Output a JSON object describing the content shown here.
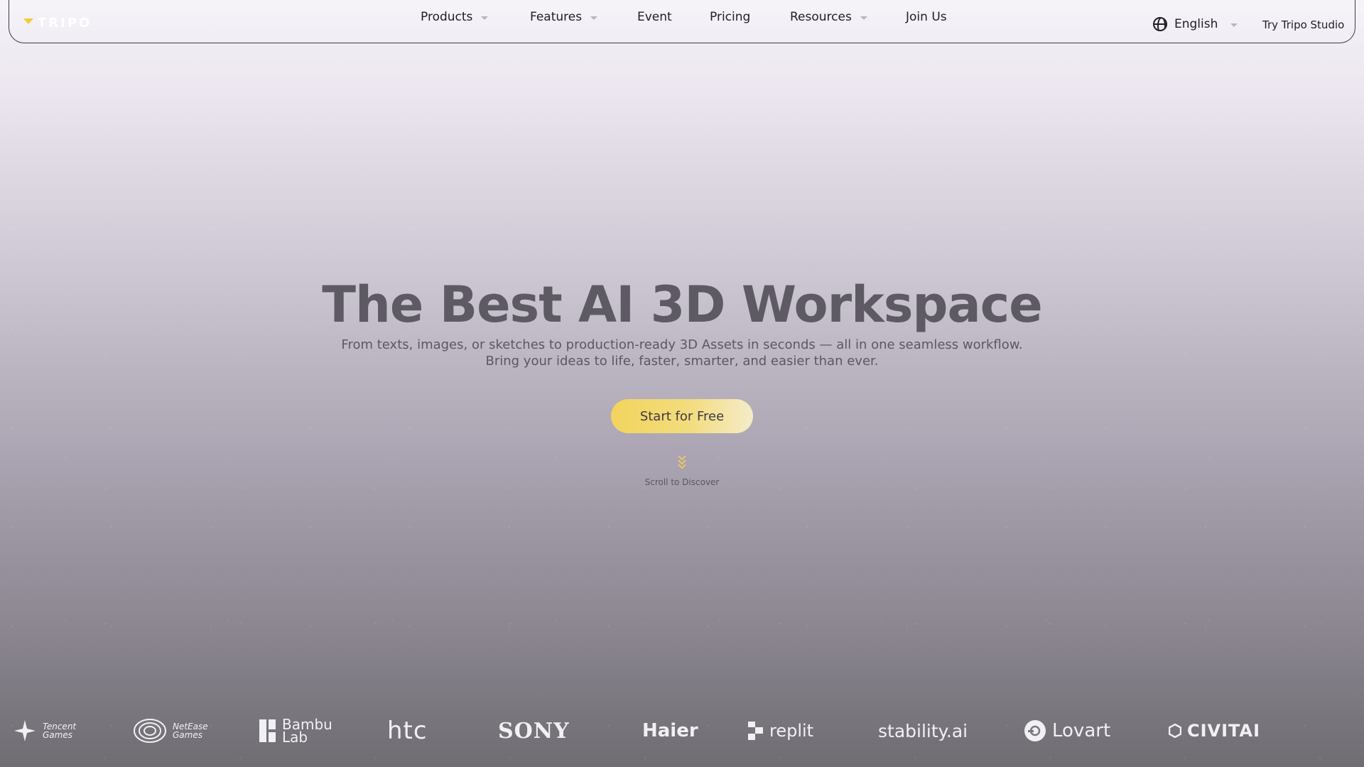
{
  "nav": {
    "logo_text": "TRIPO",
    "menu": [
      {
        "label": "Products",
        "has_dropdown": true
      },
      {
        "label": "Features",
        "has_dropdown": true
      },
      {
        "label": "Event",
        "has_dropdown": false
      },
      {
        "label": "Pricing",
        "has_dropdown": false
      },
      {
        "label": "Resources",
        "has_dropdown": true
      },
      {
        "label": "Join Us",
        "has_dropdown": false
      }
    ],
    "language": "English",
    "try_label": "Try Tripo Studio"
  },
  "hero": {
    "title": "The Best AI 3D Workspace",
    "subtitle_line1": "From texts, images, or sketches to production-ready 3D Assets in seconds — all in one seamless workflow.",
    "subtitle_line2": "Bring your ideas to life, faster, smarter, and easier than ever.",
    "cta_label": "Start for Free",
    "scroll_label": "Scroll to Discover"
  },
  "partners": {
    "tencent": {
      "line1": "Tencent",
      "line2": "Games"
    },
    "netease": {
      "line1": "NetEase",
      "line2": "Games"
    },
    "bambu": {
      "line1": "Bambu",
      "line2": "Lab"
    },
    "htc": "htc",
    "sony": "SONY",
    "haier": "Haier",
    "replit": "replit",
    "stability": "stability.ai",
    "lovart": "Lovart",
    "civitai": "CIVITAI"
  },
  "colors": {
    "accent": "#f2cc3a",
    "cta_start": "#f2d45e",
    "cta_end": "#f4ecc8",
    "title": "#5d5a63"
  }
}
